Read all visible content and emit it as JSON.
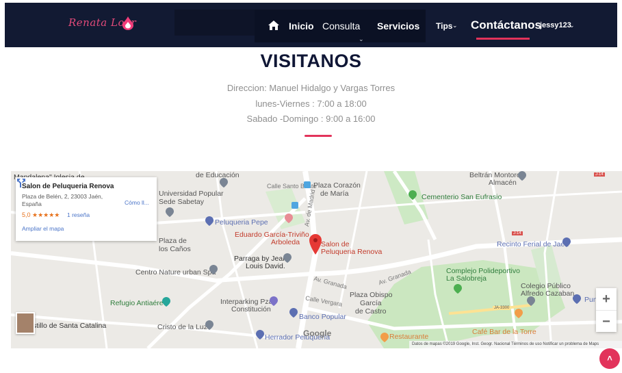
{
  "nav": {
    "logo": "Renata Loor",
    "inicio": "Inicio",
    "consulta": "Consulta",
    "servicios": "Servicios",
    "tips": "Tips",
    "contactanos": "Contáctanos",
    "user": "jessy123",
    "caret": "⌄"
  },
  "section": {
    "title": "VISITANOS",
    "address": "Direccion: Manuel Hidalgo y Vargas Torres",
    "weekdays": "lunes-Viernes : 7:00 a 18:00",
    "weekend": "Sabado -Domingo : 9:00 a 16:00"
  },
  "map": {
    "card": {
      "name": "Salon de Peluqueria Renova",
      "address1": "Plaza de Belén, 2, 23003 Jaén,",
      "address2": "España",
      "rating": "5,0 ★★★★★",
      "reviews": "1 reseña",
      "expand": "Ampliar el mapa",
      "directions": "Cómo ll..."
    },
    "labels": {
      "mandalena": "Mandalena\" Iglesia de",
      "educacion": "de Educación",
      "universidad": "Universidad Popular",
      "sede": "Sede Sabetay",
      "calle_beato": "Calle Santo Beato",
      "plaza_corazon1": "Plaza Corazón",
      "plaza_corazon2": "de María",
      "beltran1": "Beltrán Montoro",
      "beltran2": "Almacén",
      "j14a": "J-14",
      "cementerio": "Cementerio San Eufrasio",
      "peluqueria_pepe": "Peluqueria Pepe",
      "eduardo": "Eduardo García-Triviño",
      "arboleda": "Arboleda",
      "av_madrid": "Av. de Madrid",
      "salon1": "Salon de",
      "salon2": "Peluqueria Renova",
      "j14b": "J-14",
      "recinto": "Recinto Ferial de Jaén",
      "plaza_canos1": "Plaza de",
      "plaza_canos2": "los Caños",
      "parraga1": "Parraga by Jean",
      "parraga2": "Louis David.",
      "av_granada": "Av. Granada",
      "av_granada2": "Av. Granada",
      "complejo1": "Complejo Polideportivo",
      "complejo2": "La Salobreja",
      "centro_nature": "Centro Nature urban Spa",
      "av_granada3": "Av. Granada",
      "colegio1": "Colegio Público",
      "colegio2": "Alfredo Cazaban",
      "punt": "Punt",
      "refugio": "Refugio Antiaéreo",
      "calle_vergara": "Calle Vergara",
      "plaza_obispo1": "Plaza Obispo",
      "plaza_obispo2": "García",
      "plaza_obispo3": "de Castro",
      "interparking1": "Interparking Pza.",
      "interparking2": "Constitución",
      "ja3300": "JA-3300",
      "banco": "Banco Popular",
      "castillo": "astillo de Santa Catalina",
      "cristo": "Cristo de la Luz",
      "herrador": "Herrador Peluquería",
      "cafe": "Café Bar de la Torre",
      "restaurante": "Restaurante"
    },
    "google": "Google",
    "attribution": "Datos de mapas ©2019 Google, Inst. Geogr. Nacional   Términos de uso   Notificar un problema de Maps",
    "zoom_in": "+",
    "zoom_out": "−"
  },
  "scroll_top": "˄",
  "colors": {
    "navbar": "#121a33",
    "accent": "#e2335b",
    "title": "#0f1635",
    "info_text": "#8f8f8f",
    "map_pin": "#e53935"
  },
  "icons": {
    "logo": "flame-drop-icon",
    "home": "home-icon",
    "directions": "directions-icon",
    "pin": "map-pin-icon"
  }
}
